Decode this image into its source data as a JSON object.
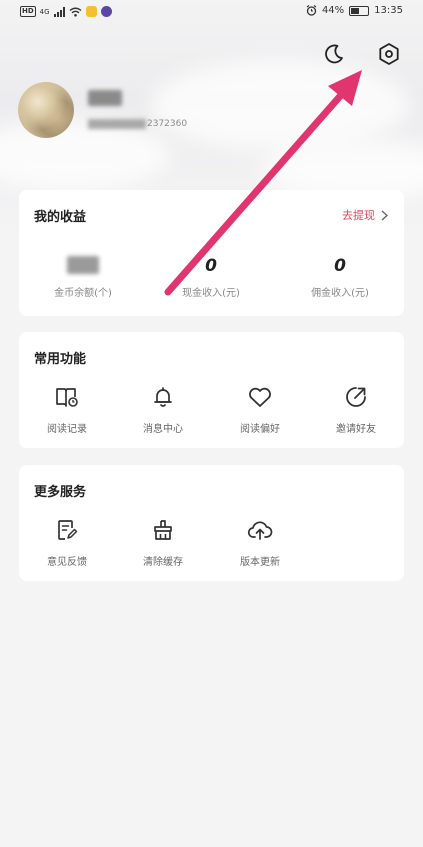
{
  "status_bar": {
    "left_badge": "HD",
    "network": "4G",
    "battery": "44%",
    "time": "13:35"
  },
  "header_icons": {
    "night_mode": "moon-icon",
    "settings": "gear-icon"
  },
  "profile": {
    "userid_suffix": "2372360"
  },
  "earnings": {
    "title": "我的收益",
    "withdraw_label": "去提现",
    "items": [
      {
        "value": "",
        "label": "金币余额(个)"
      },
      {
        "value": "0",
        "label": "现金收入(元)"
      },
      {
        "value": "0",
        "label": "佣金收入(元)"
      }
    ]
  },
  "common_functions": {
    "title": "常用功能",
    "items": [
      {
        "label": "阅读记录",
        "icon": "reading-history-icon"
      },
      {
        "label": "消息中心",
        "icon": "bell-icon"
      },
      {
        "label": "阅读偏好",
        "icon": "heart-icon"
      },
      {
        "label": "邀请好友",
        "icon": "share-icon"
      }
    ]
  },
  "more_services": {
    "title": "更多服务",
    "items": [
      {
        "label": "意见反馈",
        "icon": "feedback-icon"
      },
      {
        "label": "清除缓存",
        "icon": "broom-icon"
      },
      {
        "label": "版本更新",
        "icon": "cloud-upload-icon"
      }
    ]
  },
  "colors": {
    "accent_red": "#d8485a",
    "annotation_arrow": "#e0356e",
    "background": "#f4f4f5"
  }
}
